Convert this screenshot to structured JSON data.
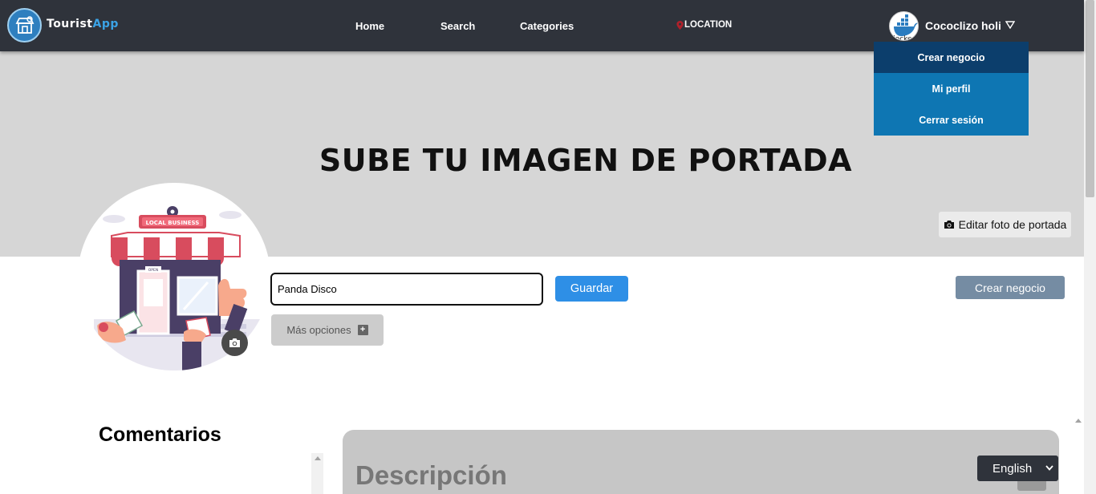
{
  "navbar": {
    "brand_part1": "Tourist",
    "brand_part2": "App",
    "links": [
      "Home",
      "Search",
      "Categories"
    ],
    "location": "LOCATION",
    "user_name": "Cococlizo holi",
    "avatar_text": "docke"
  },
  "user_menu": {
    "items": [
      "Crear negocio",
      "Mi perfil",
      "Cerrar sesión"
    ],
    "active_index": 0
  },
  "cover": {
    "title": "SUBE TU IMAGEN DE PORTADA",
    "edit_button": "Editar foto de portada"
  },
  "profile_image": {
    "sign_text": "LOCAL BUSINESS",
    "door_text": "OPEN"
  },
  "business_form": {
    "name_value": "Panda Disco",
    "save_button": "Guardar",
    "more_options": "Más opciones",
    "create_button": "Crear negocio"
  },
  "comments": {
    "title": "Comentarios"
  },
  "description": {
    "title": "Descripción"
  },
  "language_select": {
    "selected": "English"
  },
  "colors": {
    "navbar": "#2f333b",
    "accent_blue": "#2e8fe6",
    "dropdown": "#0e76b3",
    "dropdown_active": "#0c3e6c"
  }
}
